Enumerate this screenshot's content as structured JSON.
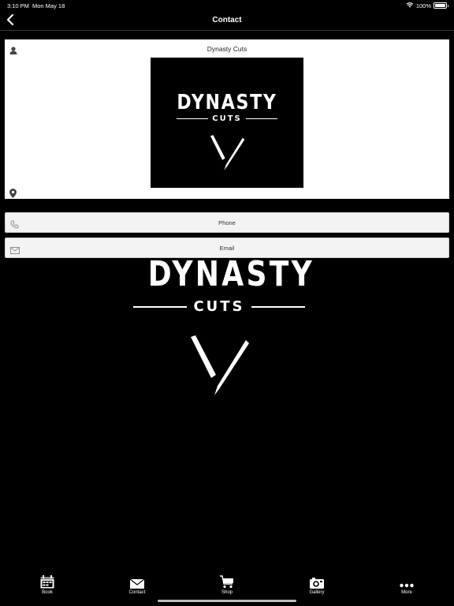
{
  "status_bar": {
    "time": "3:10 PM",
    "date": "Mon May 18",
    "battery": "100%",
    "battery_level": 1.0,
    "wifi_icon": "wifi-icon"
  },
  "nav": {
    "title": "Contact",
    "back_icon": "chevron-left-icon"
  },
  "contact_card": {
    "name_icon": "person-icon",
    "business_name": "Dynasty Cuts",
    "location_icon": "location-pin-icon"
  },
  "logo": {
    "word": "DYNASTY",
    "sub": "CUTS",
    "razor_icon": "razor-icon"
  },
  "actions": {
    "phone_label": "Phone",
    "phone_icon": "phone-icon",
    "email_label": "Email",
    "email_icon": "envelope-icon"
  },
  "tabs": [
    {
      "label": "Book",
      "icon": "calendar-icon"
    },
    {
      "label": "Contact",
      "icon": "envelope-icon"
    },
    {
      "label": "Shop",
      "icon": "cart-icon"
    },
    {
      "label": "Gallery",
      "icon": "camera-icon"
    },
    {
      "label": "More",
      "icon": "more-dots-icon"
    }
  ],
  "colors": {
    "background": "#000000",
    "card": "#ffffff",
    "action_row": "#f3f3f3",
    "text_light": "#ffffff",
    "text_dark": "#222222"
  }
}
